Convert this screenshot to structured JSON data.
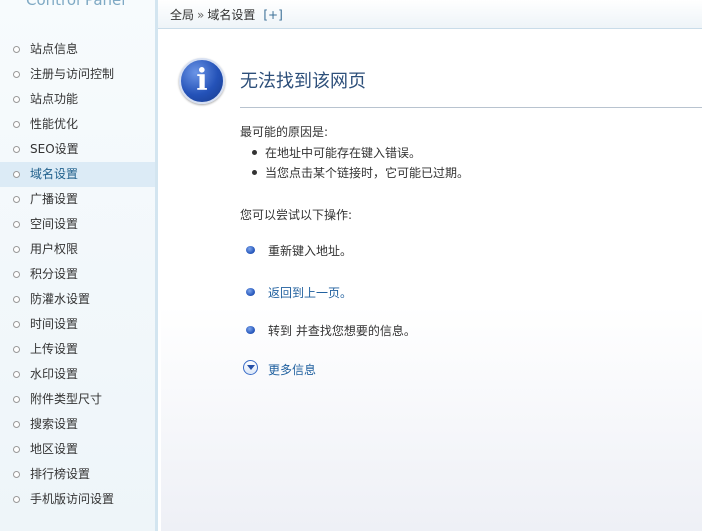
{
  "sidebar": {
    "logo_text": "Control Panel",
    "items": [
      {
        "label": "站点信息"
      },
      {
        "label": "注册与访问控制"
      },
      {
        "label": "站点功能"
      },
      {
        "label": "性能优化"
      },
      {
        "label": "SEO设置"
      },
      {
        "label": "域名设置"
      },
      {
        "label": "广播设置"
      },
      {
        "label": "空间设置"
      },
      {
        "label": "用户权限"
      },
      {
        "label": "积分设置"
      },
      {
        "label": "防灌水设置"
      },
      {
        "label": "时间设置"
      },
      {
        "label": "上传设置"
      },
      {
        "label": "水印设置"
      },
      {
        "label": "附件类型尺寸"
      },
      {
        "label": "搜索设置"
      },
      {
        "label": "地区设置"
      },
      {
        "label": "排行榜设置"
      },
      {
        "label": "手机版访问设置"
      }
    ],
    "active_index": 5
  },
  "breadcrumb": {
    "root": "全局",
    "separator": "»",
    "current": "域名设置",
    "add_label": "[+]"
  },
  "error_page": {
    "title": "无法找到该网页",
    "reasons_heading": "最可能的原因是:",
    "reasons": [
      "在地址中可能存在键入错误。",
      "当您点击某个链接时，它可能已过期。"
    ],
    "try_heading": "您可以尝试以下操作:",
    "actions": [
      "重新键入地址。",
      "返回到上一页。",
      "转到  并查找您想要的信息。"
    ],
    "more_info": "更多信息"
  },
  "colors": {
    "sidebar_bg": "#eef5f9",
    "active_item_bg": "#dcebf6",
    "title_color": "#2d4f7a",
    "link_color": "#1f5f9e",
    "info_icon_blue": "#2452b8"
  },
  "icons": {
    "page_icon": "info-icon",
    "action_bullet": "blue-ball-icon",
    "more_info": "chevron-down-circle-icon"
  }
}
